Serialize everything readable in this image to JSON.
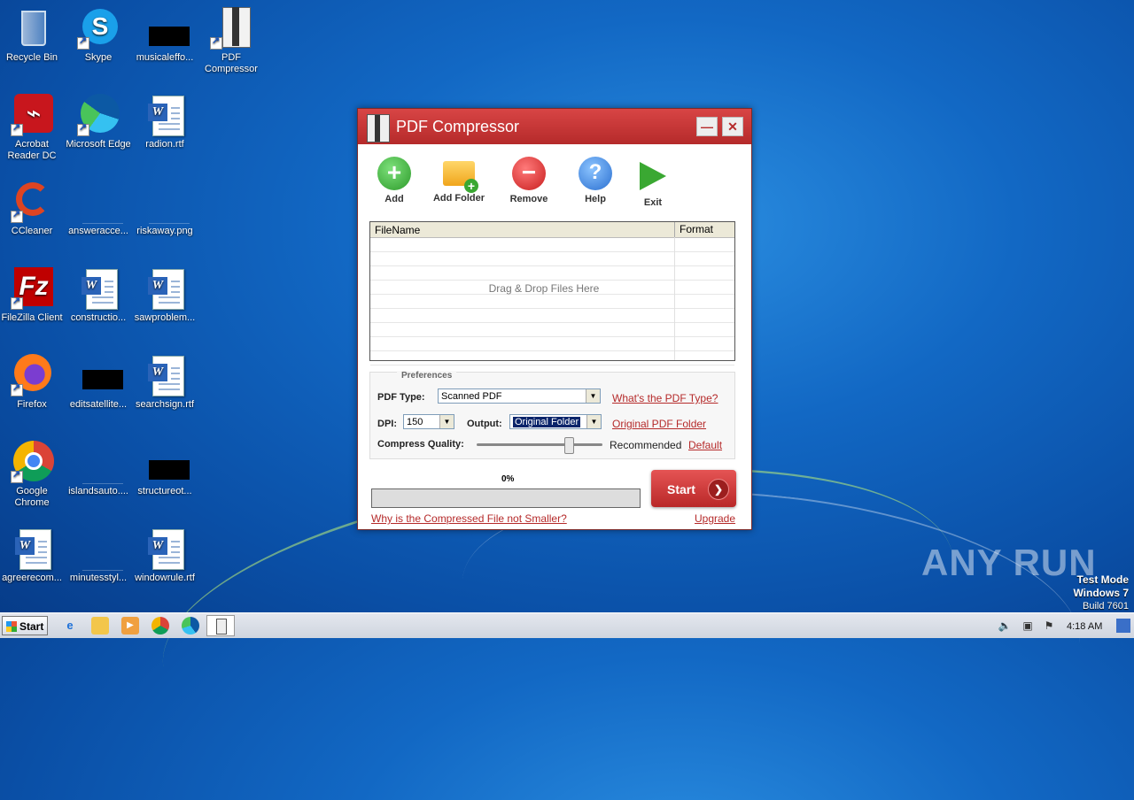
{
  "desktop": {
    "icons": [
      {
        "label": "Recycle Bin"
      },
      {
        "label": "Skype"
      },
      {
        "label": "musicaleffo..."
      },
      {
        "label": "PDF Compressor"
      },
      {
        "label": "Acrobat Reader DC"
      },
      {
        "label": "Microsoft Edge"
      },
      {
        "label": "radion.rtf"
      },
      {
        "label": "CCleaner"
      },
      {
        "label": "answeracce..."
      },
      {
        "label": "riskaway.png"
      },
      {
        "label": "FileZilla Client"
      },
      {
        "label": "constructio..."
      },
      {
        "label": "sawproblem..."
      },
      {
        "label": "Firefox"
      },
      {
        "label": "editsatellite..."
      },
      {
        "label": "searchsign.rtf"
      },
      {
        "label": "Google Chrome"
      },
      {
        "label": "islandsauto...."
      },
      {
        "label": "structureot..."
      },
      {
        "label": "agreerecom..."
      },
      {
        "label": "minutesstyl..."
      },
      {
        "label": "windowrule.rtf"
      }
    ]
  },
  "app": {
    "title": "PDF Compressor",
    "minimize": "—",
    "close": "✕",
    "toolbar": {
      "add": "Add",
      "add_folder": "Add Folder",
      "remove": "Remove",
      "help": "Help",
      "exit": "Exit"
    },
    "filelist": {
      "col_filename": "FileName",
      "col_format": "Format",
      "drop_hint": "Drag & Drop Files Here"
    },
    "prefs": {
      "legend": "Preferences",
      "pdf_type_label": "PDF Type:",
      "pdf_type_value": "Scanned PDF",
      "pdf_type_link": "What's the PDF Type?",
      "dpi_label": "DPI:",
      "dpi_value": "150",
      "output_label": "Output:",
      "output_value": "Original Folder",
      "output_link": "Original PDF Folder",
      "quality_label": "Compress Quality:",
      "quality_value": "Recommended",
      "quality_level": 0.75,
      "default_link": "Default"
    },
    "progress_text": "0%",
    "progress_value": 0,
    "start": "Start",
    "why_link": "Why is the Compressed File not Smaller?",
    "upgrade_link": "Upgrade"
  },
  "taskbar": {
    "start": "Start",
    "clock": "4:18 AM"
  },
  "watermark": "ANY RUN",
  "test_mode": {
    "line1": "Test Mode",
    "line2": "Windows 7",
    "line3": "Build 7601"
  },
  "colors": {
    "accent": "#b52a2a",
    "desktop": "#1268c4"
  }
}
